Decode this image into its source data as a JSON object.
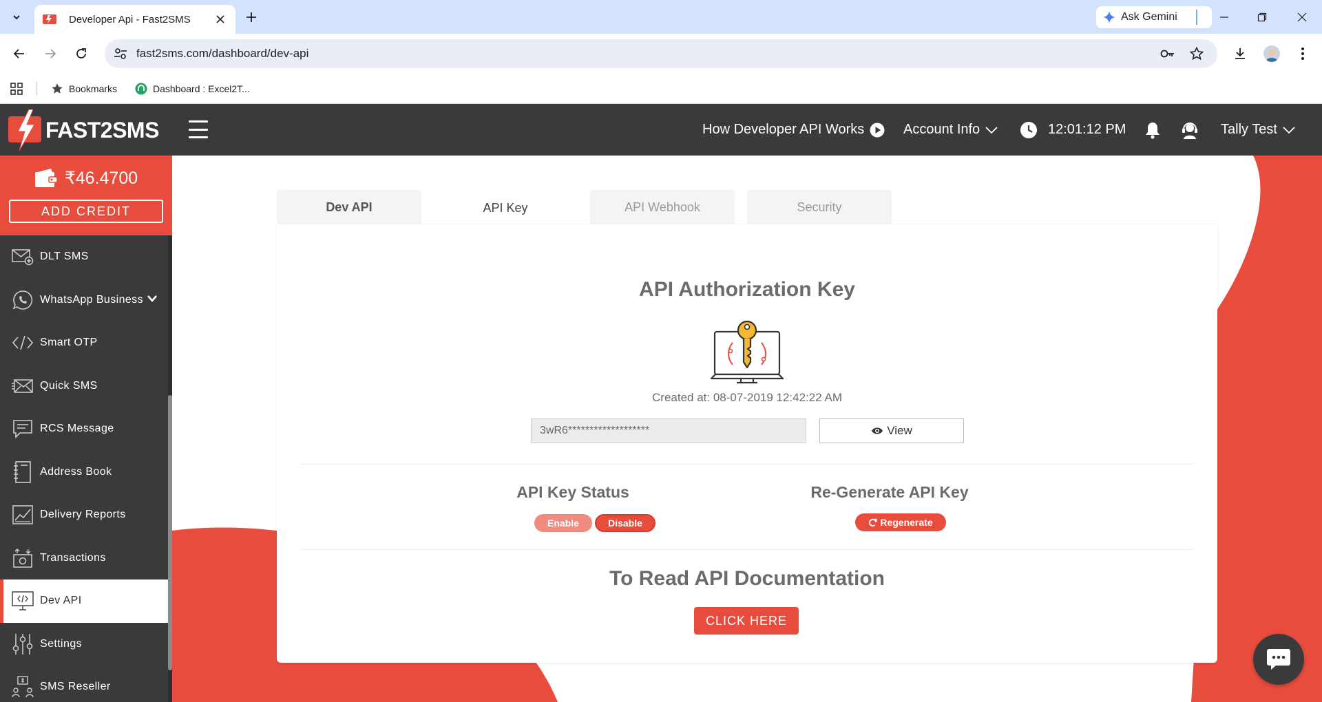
{
  "browser": {
    "tab_title": "Developer Api - Fast2SMS",
    "gemini_label": "Ask Gemini",
    "url": "fast2sms.com/dashboard/dev-api",
    "bookmarks": [
      {
        "label": "Bookmarks",
        "icon": "star-icon"
      },
      {
        "label": "Dashboard : Excel2T...",
        "icon": "green-favicon-icon"
      }
    ]
  },
  "header": {
    "logo_text": "FAST2SMS",
    "how_it_works": "How Developer API Works",
    "account_info": "Account Info",
    "time": "12:01:12 PM",
    "user_name": "Tally Test"
  },
  "sidebar": {
    "balance": "₹46.4700",
    "add_credit": "ADD CREDIT",
    "items": [
      {
        "label": "DLT SMS",
        "icon": "envelope-plus-icon"
      },
      {
        "label": "WhatsApp Business",
        "icon": "whatsapp-icon"
      },
      {
        "label": "Smart OTP",
        "icon": "code-icon"
      },
      {
        "label": "Quick SMS",
        "icon": "envelope-icon"
      },
      {
        "label": "RCS Message",
        "icon": "chat-icon"
      },
      {
        "label": "Address Book",
        "icon": "address-book-icon"
      },
      {
        "label": "Delivery Reports",
        "icon": "chart-icon"
      },
      {
        "label": "Transactions",
        "icon": "transactions-icon"
      },
      {
        "label": "Dev API",
        "icon": "monitor-code-icon"
      },
      {
        "label": "Settings",
        "icon": "sliders-icon"
      },
      {
        "label": "SMS Reseller",
        "icon": "reseller-icon"
      }
    ]
  },
  "main": {
    "tabs": [
      {
        "label": "Dev API"
      },
      {
        "label": "API Key"
      },
      {
        "label": "API Webhook"
      },
      {
        "label": "Security"
      }
    ],
    "title": "API Authorization Key",
    "created_at": "Created at: 08-07-2019 12:42:22 AM",
    "api_key_masked": "3wR6*******************",
    "view_label": "View",
    "status_title": "API Key Status",
    "enable_label": "Enable",
    "disable_label": "Disable",
    "regen_title": "Re-Generate API Key",
    "regen_label": "Regenerate",
    "docs_title": "To Read API Documentation",
    "click_here": "CLICK HERE"
  },
  "colors": {
    "brand_red": "#e84c3d",
    "dark_bg": "#3a3a3c",
    "enable_pink": "#f08b80"
  }
}
